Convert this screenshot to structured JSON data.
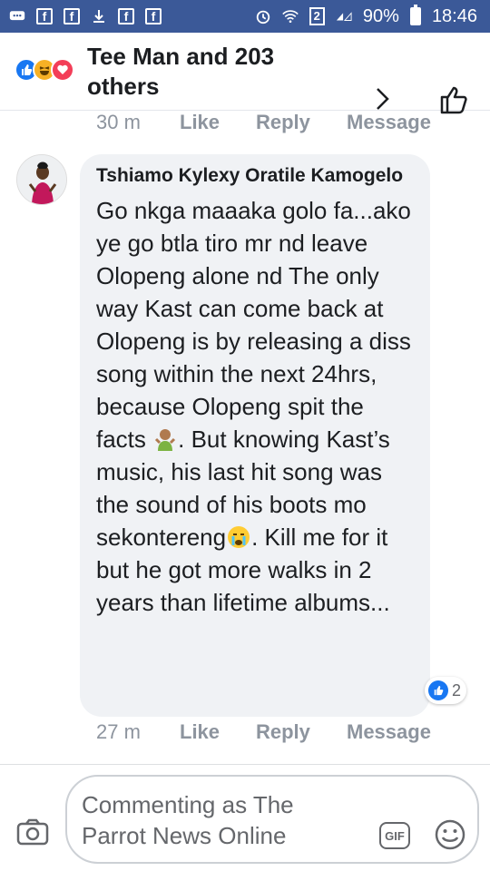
{
  "status_bar": {
    "sim": "2",
    "battery": "90%",
    "time": "18:46"
  },
  "header": {
    "title": "Tee Man and 203 others",
    "reactions": [
      "like-icon",
      "haha-icon",
      "love-icon"
    ]
  },
  "previous_comment": {
    "time": "30 m",
    "like": "Like",
    "reply": "Reply",
    "message": "Message"
  },
  "comment": {
    "author": "Tshiamo Kylexy Oratile Kamogelo",
    "text_part1": "Go nkga maaaka golo fa...ako ye go btla tiro mr nd leave Olopeng alone nd The only way Kast can come back at Olopeng is by releasing a diss song within the next 24hrs, because Olopeng spit the facts ",
    "text_part2": ". But knowing Kast’s music, his last hit song was the sound of his boots mo sekontereng",
    "text_part3": ". Kill me for it but he got more walks in 2 years than lifetime albums...",
    "reaction_count": "2",
    "time": "27 m",
    "like": "Like",
    "reply": "Reply",
    "message": "Message"
  },
  "composer": {
    "placeholder": "Commenting as The Parrot News Online",
    "gif_label": "GIF"
  },
  "colors": {
    "status_bar": "#3b5998",
    "bubble": "#f0f2f5",
    "meta_text": "#8d949e",
    "like_blue": "#1877f2"
  }
}
